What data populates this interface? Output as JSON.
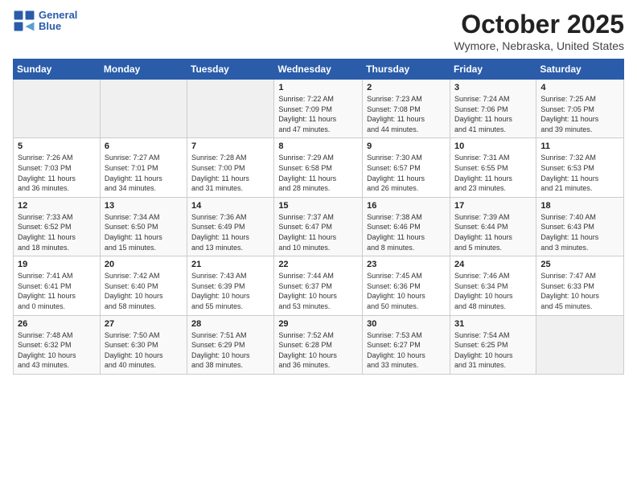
{
  "header": {
    "logo_line1": "General",
    "logo_line2": "Blue",
    "title": "October 2025",
    "subtitle": "Wymore, Nebraska, United States"
  },
  "days_of_week": [
    "Sunday",
    "Monday",
    "Tuesday",
    "Wednesday",
    "Thursday",
    "Friday",
    "Saturday"
  ],
  "weeks": [
    [
      {
        "num": "",
        "info": ""
      },
      {
        "num": "",
        "info": ""
      },
      {
        "num": "",
        "info": ""
      },
      {
        "num": "1",
        "info": "Sunrise: 7:22 AM\nSunset: 7:09 PM\nDaylight: 11 hours\nand 47 minutes."
      },
      {
        "num": "2",
        "info": "Sunrise: 7:23 AM\nSunset: 7:08 PM\nDaylight: 11 hours\nand 44 minutes."
      },
      {
        "num": "3",
        "info": "Sunrise: 7:24 AM\nSunset: 7:06 PM\nDaylight: 11 hours\nand 41 minutes."
      },
      {
        "num": "4",
        "info": "Sunrise: 7:25 AM\nSunset: 7:05 PM\nDaylight: 11 hours\nand 39 minutes."
      }
    ],
    [
      {
        "num": "5",
        "info": "Sunrise: 7:26 AM\nSunset: 7:03 PM\nDaylight: 11 hours\nand 36 minutes."
      },
      {
        "num": "6",
        "info": "Sunrise: 7:27 AM\nSunset: 7:01 PM\nDaylight: 11 hours\nand 34 minutes."
      },
      {
        "num": "7",
        "info": "Sunrise: 7:28 AM\nSunset: 7:00 PM\nDaylight: 11 hours\nand 31 minutes."
      },
      {
        "num": "8",
        "info": "Sunrise: 7:29 AM\nSunset: 6:58 PM\nDaylight: 11 hours\nand 28 minutes."
      },
      {
        "num": "9",
        "info": "Sunrise: 7:30 AM\nSunset: 6:57 PM\nDaylight: 11 hours\nand 26 minutes."
      },
      {
        "num": "10",
        "info": "Sunrise: 7:31 AM\nSunset: 6:55 PM\nDaylight: 11 hours\nand 23 minutes."
      },
      {
        "num": "11",
        "info": "Sunrise: 7:32 AM\nSunset: 6:53 PM\nDaylight: 11 hours\nand 21 minutes."
      }
    ],
    [
      {
        "num": "12",
        "info": "Sunrise: 7:33 AM\nSunset: 6:52 PM\nDaylight: 11 hours\nand 18 minutes."
      },
      {
        "num": "13",
        "info": "Sunrise: 7:34 AM\nSunset: 6:50 PM\nDaylight: 11 hours\nand 15 minutes."
      },
      {
        "num": "14",
        "info": "Sunrise: 7:36 AM\nSunset: 6:49 PM\nDaylight: 11 hours\nand 13 minutes."
      },
      {
        "num": "15",
        "info": "Sunrise: 7:37 AM\nSunset: 6:47 PM\nDaylight: 11 hours\nand 10 minutes."
      },
      {
        "num": "16",
        "info": "Sunrise: 7:38 AM\nSunset: 6:46 PM\nDaylight: 11 hours\nand 8 minutes."
      },
      {
        "num": "17",
        "info": "Sunrise: 7:39 AM\nSunset: 6:44 PM\nDaylight: 11 hours\nand 5 minutes."
      },
      {
        "num": "18",
        "info": "Sunrise: 7:40 AM\nSunset: 6:43 PM\nDaylight: 11 hours\nand 3 minutes."
      }
    ],
    [
      {
        "num": "19",
        "info": "Sunrise: 7:41 AM\nSunset: 6:41 PM\nDaylight: 11 hours\nand 0 minutes."
      },
      {
        "num": "20",
        "info": "Sunrise: 7:42 AM\nSunset: 6:40 PM\nDaylight: 10 hours\nand 58 minutes."
      },
      {
        "num": "21",
        "info": "Sunrise: 7:43 AM\nSunset: 6:39 PM\nDaylight: 10 hours\nand 55 minutes."
      },
      {
        "num": "22",
        "info": "Sunrise: 7:44 AM\nSunset: 6:37 PM\nDaylight: 10 hours\nand 53 minutes."
      },
      {
        "num": "23",
        "info": "Sunrise: 7:45 AM\nSunset: 6:36 PM\nDaylight: 10 hours\nand 50 minutes."
      },
      {
        "num": "24",
        "info": "Sunrise: 7:46 AM\nSunset: 6:34 PM\nDaylight: 10 hours\nand 48 minutes."
      },
      {
        "num": "25",
        "info": "Sunrise: 7:47 AM\nSunset: 6:33 PM\nDaylight: 10 hours\nand 45 minutes."
      }
    ],
    [
      {
        "num": "26",
        "info": "Sunrise: 7:48 AM\nSunset: 6:32 PM\nDaylight: 10 hours\nand 43 minutes."
      },
      {
        "num": "27",
        "info": "Sunrise: 7:50 AM\nSunset: 6:30 PM\nDaylight: 10 hours\nand 40 minutes."
      },
      {
        "num": "28",
        "info": "Sunrise: 7:51 AM\nSunset: 6:29 PM\nDaylight: 10 hours\nand 38 minutes."
      },
      {
        "num": "29",
        "info": "Sunrise: 7:52 AM\nSunset: 6:28 PM\nDaylight: 10 hours\nand 36 minutes."
      },
      {
        "num": "30",
        "info": "Sunrise: 7:53 AM\nSunset: 6:27 PM\nDaylight: 10 hours\nand 33 minutes."
      },
      {
        "num": "31",
        "info": "Sunrise: 7:54 AM\nSunset: 6:25 PM\nDaylight: 10 hours\nand 31 minutes."
      },
      {
        "num": "",
        "info": ""
      }
    ]
  ]
}
